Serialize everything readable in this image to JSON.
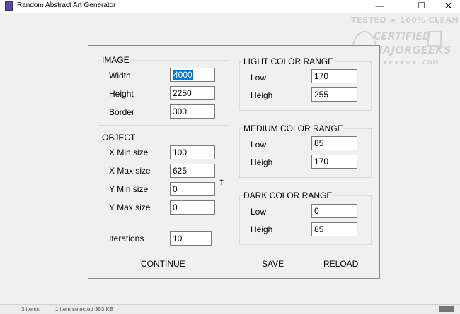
{
  "window": {
    "title": "Random Abstract Art Generator",
    "min_glyph": "—",
    "max_glyph": "☐",
    "close_glyph": "✕"
  },
  "watermark": {
    "line1": "TESTED ★ 100% CLEAN",
    "line2": "CERTIFIED",
    "line3": "MAJORGEEKS",
    "line4": "★★★★★★ .COM"
  },
  "image_group": {
    "title": "IMAGE",
    "width_label": "Width",
    "width_value": "4000",
    "height_label": "Height",
    "height_value": "2250",
    "border_label": "Border",
    "border_value": "300"
  },
  "object_group": {
    "title": "OBJECT",
    "xmin_label": "X Min size",
    "xmin_value": "100",
    "xmax_label": "X Max size",
    "xmax_value": "625",
    "ymin_label": "Y Min size",
    "ymin_value": "0",
    "ymax_label": "Y Max size",
    "ymax_value": "0",
    "marker": "‡"
  },
  "iterations": {
    "label": "Iterations",
    "value": "10"
  },
  "light_range": {
    "title": "LIGHT COLOR RANGE",
    "low_label": "Low",
    "low_value": "170",
    "high_label": "Heigh",
    "high_value": "255"
  },
  "medium_range": {
    "title": "MEDIUM COLOR RANGE",
    "low_label": "Low",
    "low_value": "85",
    "high_label": "Heigh",
    "high_value": "170"
  },
  "dark_range": {
    "title": "DARK COLOR RANGE",
    "low_label": "Low",
    "low_value": "0",
    "high_label": "Heigh",
    "high_value": "85"
  },
  "buttons": {
    "continue": "CONTINUE",
    "save": "SAVE",
    "reload": "RELOAD"
  },
  "statusbar": {
    "items_text": "3 items",
    "selected_text": "1 item selected 383 KB"
  },
  "colors": {
    "selection": "#0078d7",
    "background": "#f0f0f0",
    "app_icon": "#5b4aa3"
  }
}
